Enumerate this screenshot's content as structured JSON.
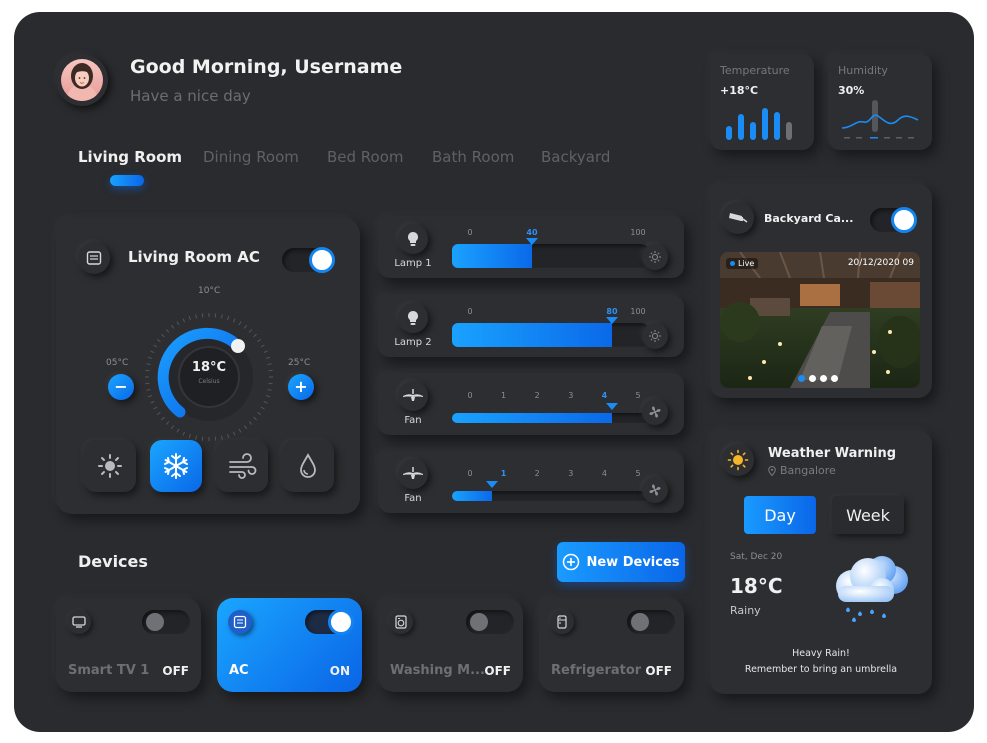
{
  "header": {
    "greeting": "Good Morning, Username",
    "subtitle": "Have a nice day"
  },
  "rooms": {
    "tabs": [
      {
        "label": "Living Room",
        "active": true
      },
      {
        "label": "Dining Room",
        "active": false
      },
      {
        "label": "Bed Room",
        "active": false
      },
      {
        "label": "Bath Room",
        "active": false
      },
      {
        "label": "Backyard",
        "active": false
      }
    ]
  },
  "ac": {
    "title": "Living Room AC",
    "power": "on",
    "current_temp": "18°C",
    "temp_caption": "Celsius",
    "top_label": "10°C",
    "min_label": "05°C",
    "max_label": "25°C",
    "minus_symbol": "−",
    "plus_symbol": "+",
    "modes": [
      {
        "icon": "sun-icon",
        "active": false
      },
      {
        "icon": "snowflake-icon",
        "active": true
      },
      {
        "icon": "wind-icon",
        "active": false
      },
      {
        "icon": "droplet-icon",
        "active": false
      }
    ]
  },
  "controls": [
    {
      "label": "Lamp 1",
      "icon": "lightbulb-icon",
      "ticks": [
        "0",
        "40",
        "100"
      ],
      "selected": "40",
      "level": 0.4,
      "action_icon": "brightness-icon"
    },
    {
      "label": "Lamp 2",
      "icon": "lightbulb-icon",
      "ticks": [
        "0",
        "80",
        "100"
      ],
      "selected": "80",
      "level": 0.8,
      "action_icon": "brightness-icon"
    },
    {
      "label": "Fan",
      "icon": "ceiling-fan-icon",
      "ticks": [
        "0",
        "1",
        "2",
        "3",
        "4",
        "5"
      ],
      "selected": "4",
      "level": 0.8,
      "action_icon": "fan-icon"
    },
    {
      "label": "Fan",
      "icon": "ceiling-fan-icon",
      "ticks": [
        "0",
        "1",
        "2",
        "3",
        "4",
        "5"
      ],
      "selected": "1",
      "level": 0.2,
      "action_icon": "fan-icon"
    }
  ],
  "devices": {
    "title": "Devices",
    "new_button": "New Devices",
    "items": [
      {
        "name": "Smart TV 1",
        "state": "OFF",
        "icon": "tv-icon"
      },
      {
        "name": "AC",
        "state": "ON",
        "icon": "ac-unit-icon"
      },
      {
        "name": "Washing M...",
        "state": "OFF",
        "icon": "washing-machine-icon"
      },
      {
        "name": "Refrigerator",
        "state": "OFF",
        "icon": "refrigerator-icon"
      }
    ]
  },
  "stats": {
    "temperature": {
      "label": "Temperature",
      "value": "+18°C"
    },
    "humidity": {
      "label": "Humidity",
      "value": "30%"
    }
  },
  "camera": {
    "title": "Backyard Ca...",
    "live": "Live",
    "timestamp": "20/12/2020 09",
    "power": "on"
  },
  "weather": {
    "title": "Weather Warning",
    "location": "Bangalore",
    "day_button": "Day",
    "week_button": "Week",
    "date": "Sat, Dec 20",
    "temp": "18°C",
    "condition": "Rainy",
    "warning_line1": "Heavy Rain!",
    "warning_line2": "Remember to bring an umbrella"
  },
  "colors": {
    "accent": "#1484f0",
    "background": "#2a2b2e",
    "card": "#2d2e31"
  }
}
